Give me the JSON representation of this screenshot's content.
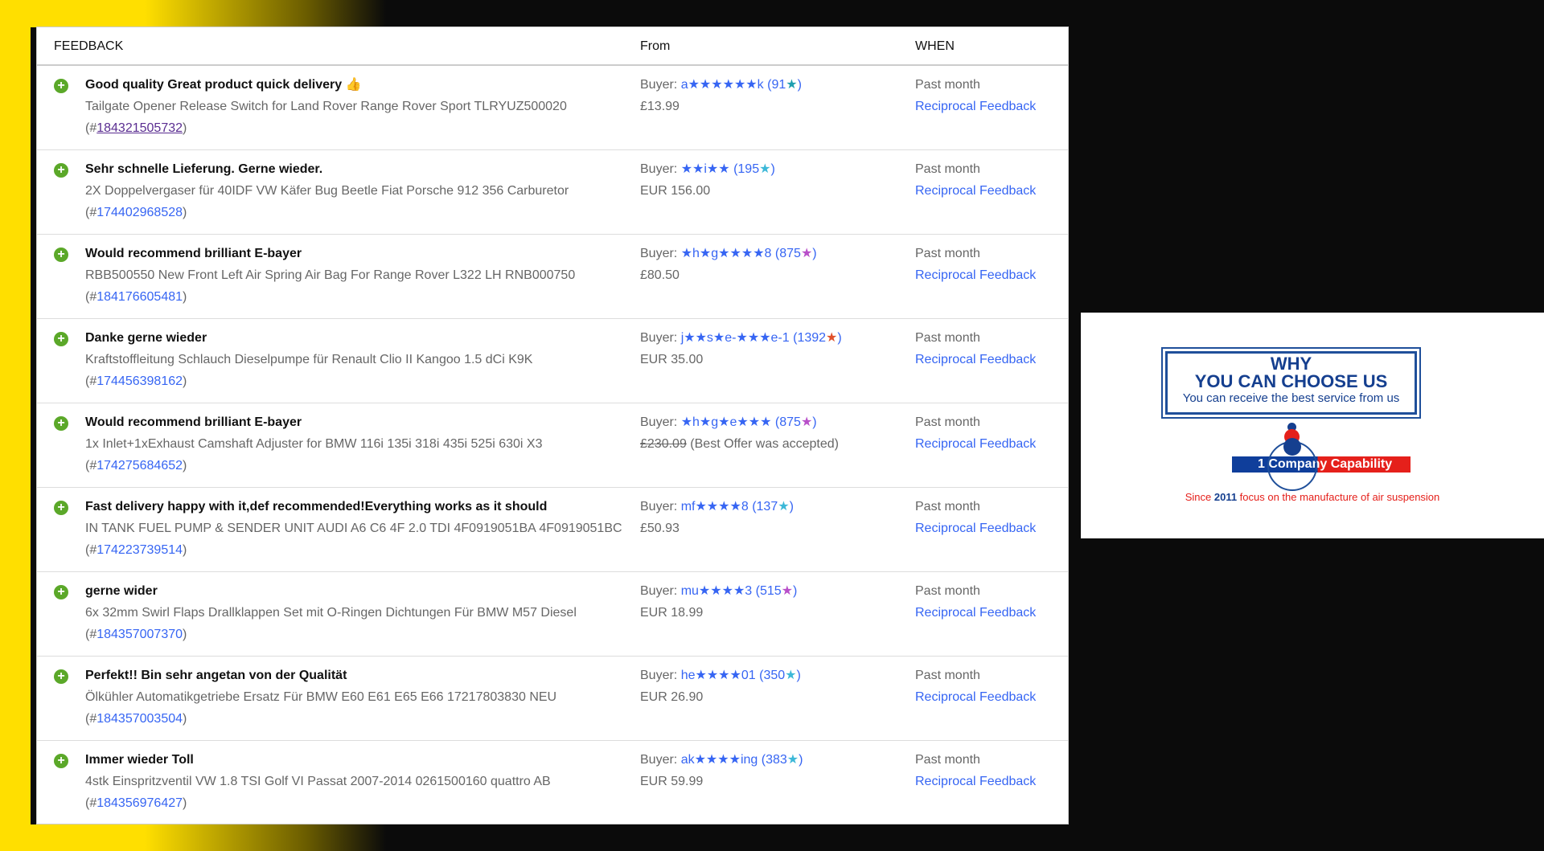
{
  "header": {
    "feedback": "FEEDBACK",
    "from": "From",
    "when": "WHEN"
  },
  "rows": [
    {
      "title": "Good quality Great product quick delivery 👍",
      "item": "Tailgate Opener Release Switch for Land Rover Range Rover Sport TLRYUZ500020",
      "id": "184321505732",
      "buyer": "a★★★★★★k",
      "score": "91",
      "star_color": "#1e9fb0",
      "price": "£13.99",
      "when": "Past month",
      "reciprocal": "Reciprocal Feedback"
    },
    {
      "title": "Sehr schnelle Lieferung. Gerne wieder.",
      "item": "2X Doppelvergaser für 40IDF VW Käfer Bug Beetle Fiat Porsche 912 356 Carburetor",
      "id": "174402968528",
      "buyer": "★★i★★",
      "score": "195",
      "star_color": "#3cb8d8",
      "price": "EUR 156.00",
      "when": "Past month",
      "reciprocal": "Reciprocal Feedback"
    },
    {
      "title": "Would recommend brilliant E-bayer",
      "item": "RBB500550 New Front Left Air Spring Air Bag For Range Rover L322 LH RNB000750",
      "id": "184176605481",
      "buyer": "★h★g★★★★8",
      "score": "875",
      "star_color": "#b84fc9",
      "price": "£80.50",
      "when": "Past month",
      "reciprocal": "Reciprocal Feedback"
    },
    {
      "title": "Danke gerne wieder",
      "item": "Kraftstoffleitung Schlauch Dieselpumpe für Renault Clio II Kangoo 1.5 dCi K9K",
      "id": "174456398162",
      "buyer": "j★★s★e-★★★e-1",
      "score": "1392",
      "star_color": "#e0502a",
      "price": "EUR 35.00",
      "when": "Past month",
      "reciprocal": "Reciprocal Feedback"
    },
    {
      "title": "Would recommend brilliant E-bayer",
      "item": "1x Inlet+1xExhaust Camshaft Adjuster for BMW 116i 135i 318i 435i 525i 630i X3",
      "id": "174275684652",
      "buyer": "★h★g★e★★★",
      "score": "875",
      "star_color": "#b84fc9",
      "price_old": "£230.09",
      "price_note": "(Best Offer was accepted)",
      "when": "Past month",
      "reciprocal": "Reciprocal Feedback"
    },
    {
      "title": "Fast delivery happy with it,def recommended!Everything works as it should",
      "item": "IN TANK FUEL PUMP & SENDER UNIT AUDI A6 C6 4F 2.0 TDI 4F0919051BA 4F0919051BC (#",
      "id": "174223739514",
      "buyer": "mf★★★★8",
      "score": "137",
      "star_color": "#3cb8d8",
      "price": "£50.93",
      "when": "Past month",
      "reciprocal": "Reciprocal Feedback"
    },
    {
      "title": "gerne wider",
      "item": "6x 32mm Swirl Flaps Drallklappen Set mit O-Ringen Dichtungen Für BMW M57 Diesel",
      "id": "184357007370",
      "buyer": "mu★★★★3",
      "score": "515",
      "star_color": "#b84fc9",
      "price": "EUR 18.99",
      "when": "Past month",
      "reciprocal": "Reciprocal Feedback"
    },
    {
      "title": "Perfekt!! Bin sehr angetan von der Qualität",
      "item": "Ölkühler Automatikgetriebe Ersatz Für BMW E60 E61 E65 E66 17217803830 NEU",
      "id": "184357003504",
      "buyer": "he★★★★01",
      "score": "350",
      "star_color": "#3cb8d8",
      "price": "EUR 26.90",
      "when": "Past month",
      "reciprocal": "Reciprocal Feedback"
    },
    {
      "title": "Immer wieder Toll",
      "item": "4stk Einspritzventil VW 1.8 TSI Golf VI Passat 2007-2014 0261500160 quattro AB",
      "id": "184356976427",
      "buyer": "ak★★★★ing",
      "score": "383",
      "star_color": "#3cb8d8",
      "price": "EUR 59.99",
      "when": "Past month",
      "reciprocal": "Reciprocal Feedback"
    }
  ],
  "labels": {
    "buyer_prefix": "Buyer: "
  },
  "panel": {
    "why": "WHY",
    "choose": "YOU CAN CHOOSE US",
    "sub": "You can receive the best service from us",
    "capability": "1 Company Capability",
    "since_a": "Since ",
    "since_year": "2011",
    "since_b": " focus on the manufacture of air suspension"
  }
}
